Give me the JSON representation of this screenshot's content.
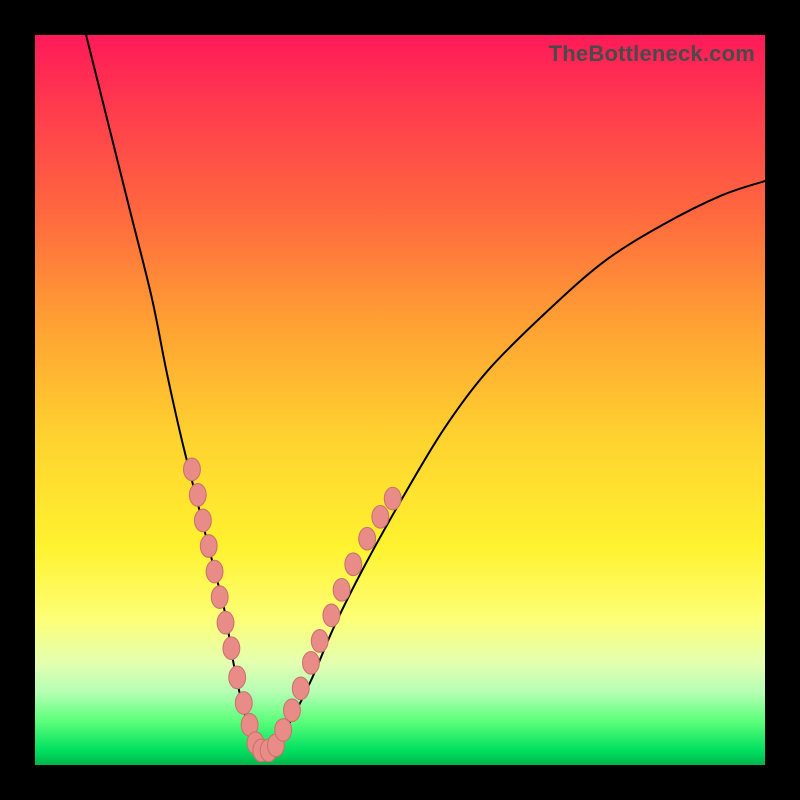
{
  "brand": "TheBottleneck.com",
  "chart_data": {
    "type": "line",
    "title": "",
    "xlabel": "",
    "ylabel": "",
    "xlim": [
      0,
      100
    ],
    "ylim": [
      0,
      100
    ],
    "series": [
      {
        "name": "bottleneck-curve",
        "x": [
          7,
          10,
          13,
          16,
          18,
          20,
          22,
          24,
          26,
          27,
          28,
          29,
          30,
          31,
          33,
          35,
          38,
          41,
          45,
          50,
          56,
          62,
          70,
          78,
          86,
          94,
          100
        ],
        "y": [
          100,
          88,
          76,
          64,
          54,
          45,
          37,
          29,
          21,
          15,
          10,
          6,
          3,
          2,
          3,
          6,
          12,
          19,
          27,
          36,
          46,
          54,
          62,
          69,
          74,
          78,
          80
        ]
      }
    ],
    "markers": {
      "name": "highlight-points",
      "left_branch": [
        {
          "x": 21.5,
          "y": 40.5
        },
        {
          "x": 22.3,
          "y": 37.0
        },
        {
          "x": 23.0,
          "y": 33.5
        },
        {
          "x": 23.8,
          "y": 30.0
        },
        {
          "x": 24.6,
          "y": 26.5
        },
        {
          "x": 25.3,
          "y": 23.0
        },
        {
          "x": 26.1,
          "y": 19.5
        },
        {
          "x": 26.9,
          "y": 16.0
        },
        {
          "x": 27.7,
          "y": 12.0
        },
        {
          "x": 28.6,
          "y": 8.5
        },
        {
          "x": 29.4,
          "y": 5.5
        }
      ],
      "bottom": [
        {
          "x": 30.2,
          "y": 3.0
        },
        {
          "x": 31.0,
          "y": 2.0
        },
        {
          "x": 32.0,
          "y": 2.0
        },
        {
          "x": 33.0,
          "y": 2.7
        }
      ],
      "right_branch": [
        {
          "x": 34.0,
          "y": 4.8
        },
        {
          "x": 35.2,
          "y": 7.5
        },
        {
          "x": 36.4,
          "y": 10.5
        },
        {
          "x": 37.8,
          "y": 14.0
        },
        {
          "x": 39.0,
          "y": 17.0
        },
        {
          "x": 40.6,
          "y": 20.5
        },
        {
          "x": 42.0,
          "y": 24.0
        },
        {
          "x": 43.6,
          "y": 27.5
        },
        {
          "x": 45.5,
          "y": 31.0
        },
        {
          "x": 47.3,
          "y": 34.0
        },
        {
          "x": 49.0,
          "y": 36.5
        }
      ]
    },
    "colors": {
      "curve": "#000000",
      "marker_fill": "#e98c87",
      "marker_stroke": "#c9736e"
    }
  }
}
